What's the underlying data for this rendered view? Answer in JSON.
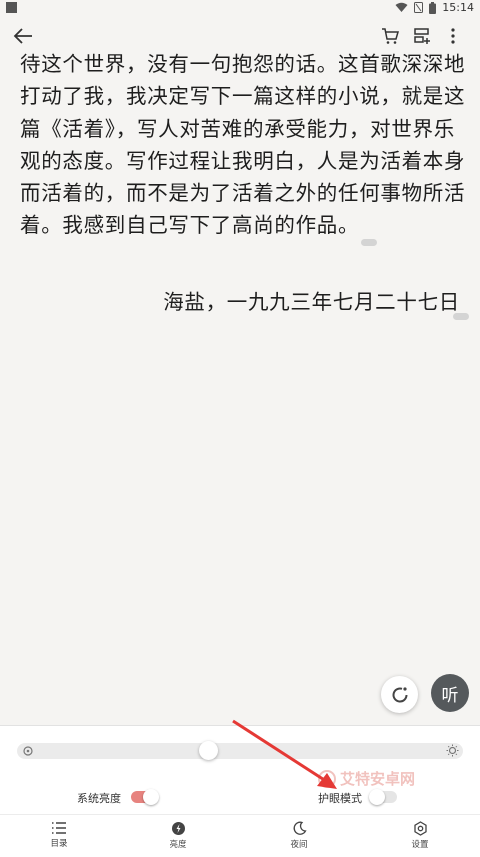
{
  "status_bar": {
    "time": "15:14"
  },
  "content": {
    "paragraph": "待这个世界，没有一句抱怨的话。这首歌深深地打动了我，我决定写下一篇这样的小说，就是这篇《活着》，写人对苦难的承受能力，对世界乐观的态度。写作过程让我明白，人是为活着本身而活着的，而不是为了活着之外的任何事物所活着。我感到自己写下了高尚的作品。",
    "signature": "海盐，一九九三年七月二十七日"
  },
  "fab": {
    "listen_label": "听"
  },
  "settings_panel": {
    "brightness_level": 0.42,
    "system_brightness_label": "系统亮度",
    "system_brightness_on": true,
    "eye_care_label": "护眼模式",
    "eye_care_on": false
  },
  "watermark_text": "艾特安卓网",
  "bottom_nav": [
    {
      "label": "目录",
      "icon": "list-icon"
    },
    {
      "label": "亮度",
      "icon": "brightness-icon"
    },
    {
      "label": "夜间",
      "icon": "moon-icon"
    },
    {
      "label": "设置",
      "icon": "gear-icon"
    }
  ],
  "colors": {
    "toggle_on": "#e7837f",
    "annotation_arrow": "#e53935"
  }
}
